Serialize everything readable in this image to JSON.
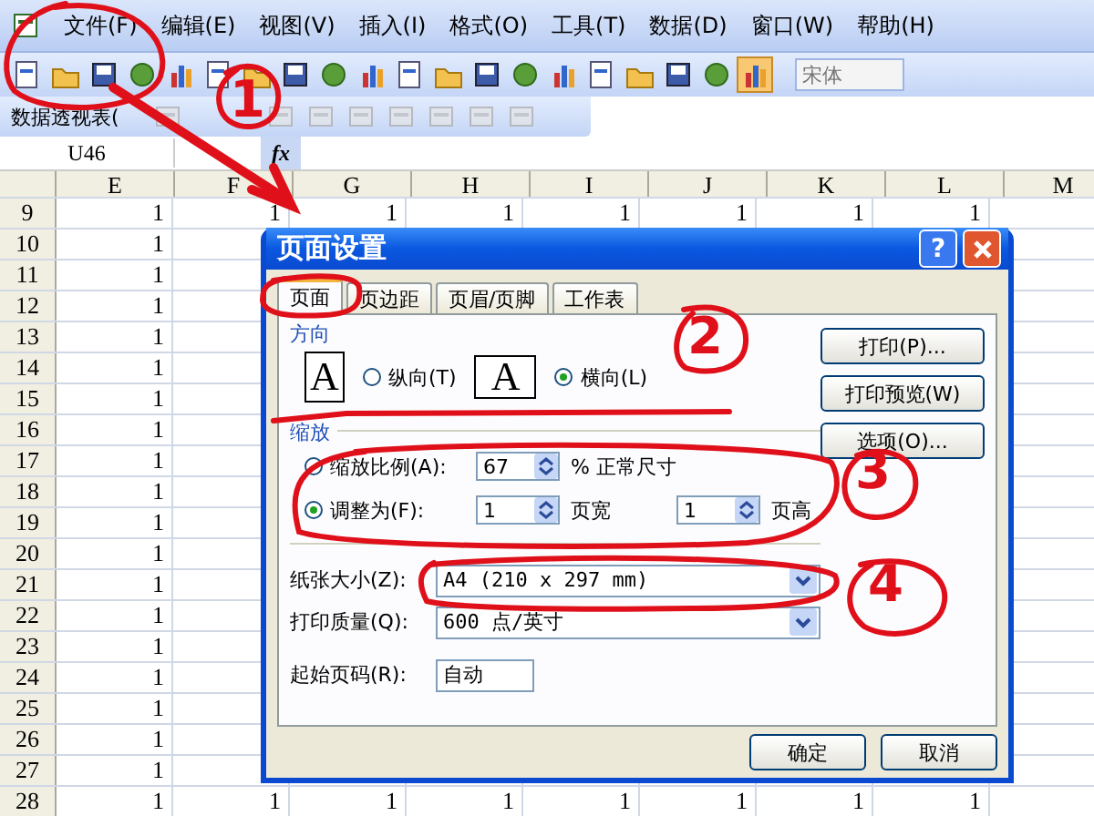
{
  "menu": [
    "文件(F)",
    "编辑(E)",
    "视图(V)",
    "插入(I)",
    "格式(O)",
    "工具(T)",
    "数据(D)",
    "窗口(W)",
    "帮助(H)"
  ],
  "toolbar": {
    "font_field": {
      "placeholder": "宋体"
    }
  },
  "pivot_toolbar": {
    "label": "数据透视表("
  },
  "formula_bar": {
    "name_box": "U46",
    "fx": "fx"
  },
  "sheet": {
    "columns": [
      "E",
      "F",
      "G",
      "H",
      "I",
      "J",
      "K",
      "L",
      "M"
    ],
    "rows": [
      {
        "header": "9",
        "cells": [
          "1",
          "1",
          "1",
          "1",
          "1",
          "1",
          "1",
          "1"
        ]
      },
      {
        "header": "10",
        "cells": [
          "1"
        ]
      },
      {
        "header": "11",
        "cells": [
          "1"
        ]
      },
      {
        "header": "12",
        "cells": [
          "1"
        ]
      },
      {
        "header": "13",
        "cells": [
          "1"
        ]
      },
      {
        "header": "14",
        "cells": [
          "1"
        ]
      },
      {
        "header": "15",
        "cells": [
          "1"
        ]
      },
      {
        "header": "16",
        "cells": [
          "1"
        ]
      },
      {
        "header": "17",
        "cells": [
          "1"
        ]
      },
      {
        "header": "18",
        "cells": [
          "1"
        ]
      },
      {
        "header": "19",
        "cells": [
          "1"
        ]
      },
      {
        "header": "20",
        "cells": [
          "1"
        ]
      },
      {
        "header": "21",
        "cells": [
          "1"
        ]
      },
      {
        "header": "22",
        "cells": [
          "1"
        ]
      },
      {
        "header": "23",
        "cells": [
          "1"
        ]
      },
      {
        "header": "24",
        "cells": [
          "1"
        ]
      },
      {
        "header": "25",
        "cells": [
          "1"
        ]
      },
      {
        "header": "26",
        "cells": [
          "1"
        ]
      },
      {
        "header": "27",
        "cells": [
          "1"
        ]
      },
      {
        "header": "28",
        "cells": [
          "1",
          "1",
          "1",
          "1",
          "1",
          "1",
          "1",
          "1"
        ]
      }
    ]
  },
  "dialog": {
    "title": "页面设置",
    "help": "?",
    "tabs": [
      {
        "label": "页面",
        "selected": true
      },
      {
        "label": "页边距",
        "selected": false
      },
      {
        "label": "页眉/页脚",
        "selected": false
      },
      {
        "label": "工作表",
        "selected": false
      }
    ],
    "orientation": {
      "label": "方向",
      "options": [
        {
          "kind": "portrait",
          "icon_letter": "A",
          "label": "纵向(T)",
          "selected": false
        },
        {
          "kind": "landscape",
          "icon_letter": "A",
          "label": "横向(L)",
          "selected": true
        }
      ]
    },
    "scaling": {
      "label": "缩放",
      "options": [
        {
          "kind": "percent",
          "label": "缩放比例(A):",
          "selected": false,
          "value": "67",
          "suffix": "% 正常尺寸"
        },
        {
          "kind": "fit",
          "label": "调整为(F):",
          "selected": true,
          "wide": "1",
          "wide_label": "页宽",
          "tall": "1",
          "tall_label": "页高"
        }
      ]
    },
    "fields": [
      {
        "kind": "dropdown",
        "label": "纸张大小(Z):",
        "value": "A4 (210 x 297 mm)"
      },
      {
        "kind": "dropdown",
        "label": "打印质量(Q):",
        "value": "600 点/英寸"
      },
      {
        "kind": "text",
        "label": "起始页码(R):",
        "value": "自动"
      }
    ],
    "side_buttons": [
      "打印(P)...",
      "打印预览(W)",
      "选项(O)..."
    ],
    "footer_buttons": [
      "确定",
      "取消"
    ]
  },
  "annotations": {
    "numbers": [
      "1",
      "2",
      "3",
      "4"
    ]
  }
}
